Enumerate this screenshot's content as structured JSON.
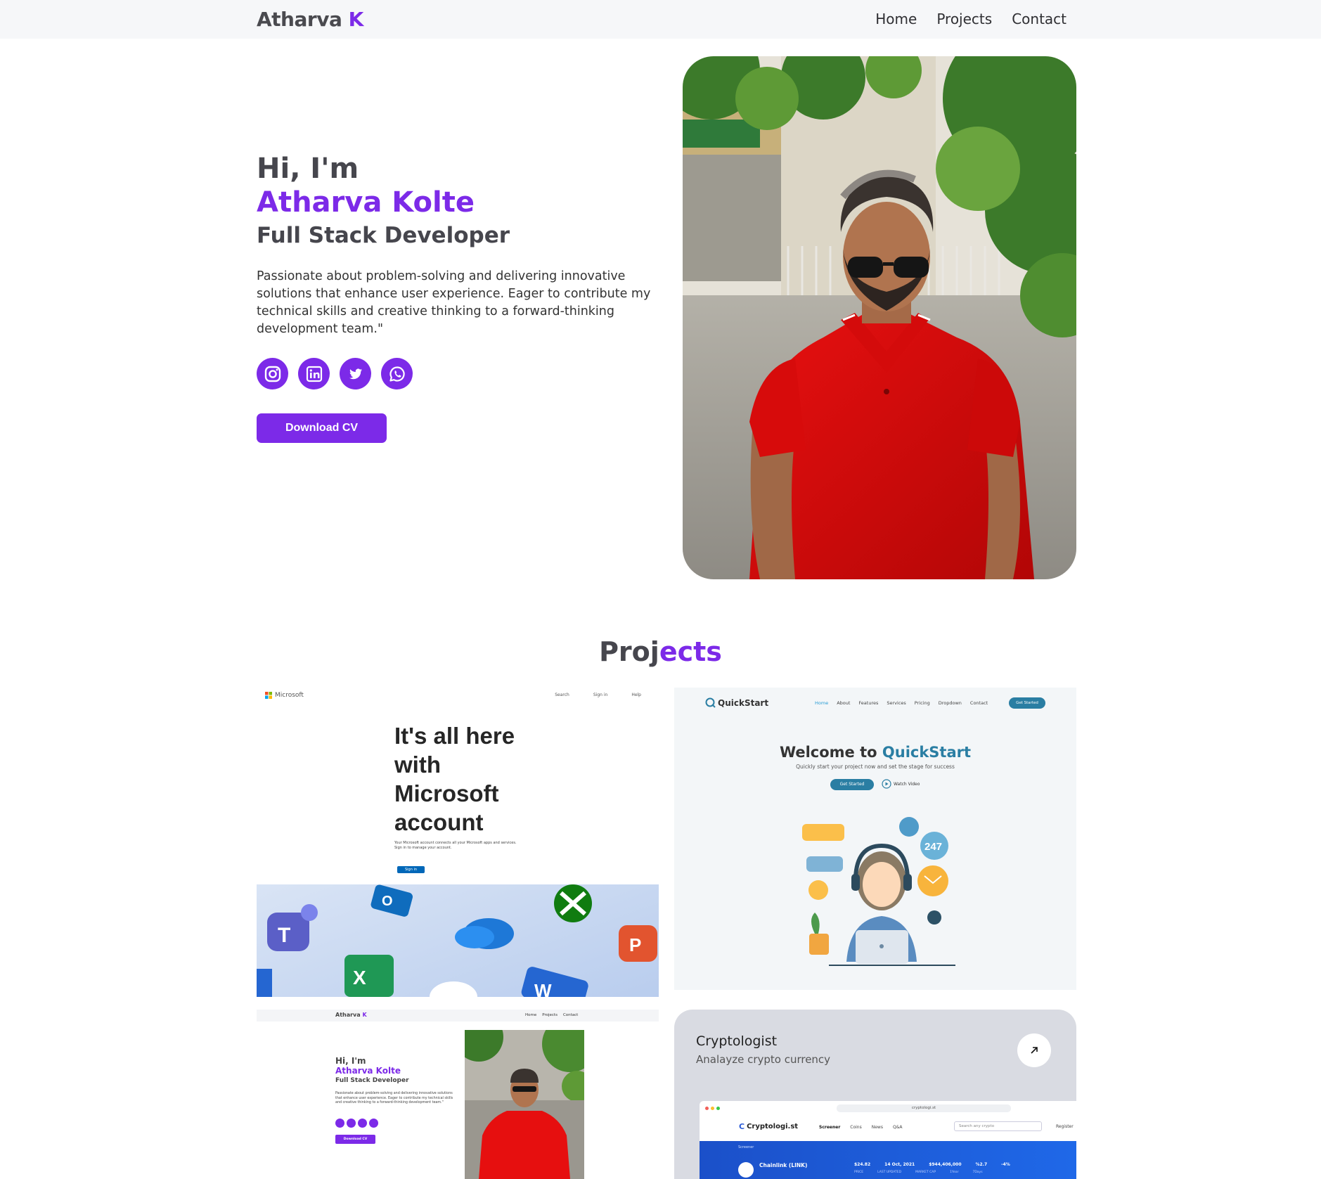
{
  "header": {
    "brand_first": "Atharva",
    "brand_last": "K",
    "nav": [
      "Home",
      "Projects",
      "Contact"
    ]
  },
  "hero": {
    "greeting": "Hi, I'm",
    "name": "Atharva Kolte",
    "role": "Full Stack Developer",
    "bio": "Passionate about problem-solving and delivering innovative solutions that enhance user experience. Eager to contribute my technical skills and creative thinking to a forward-thinking development team.\"",
    "socials": [
      "instagram-icon",
      "linkedin-icon",
      "twitter-icon",
      "whatsapp-icon"
    ],
    "cv_label": "Download CV"
  },
  "projects": {
    "title_a": "Proj",
    "title_b": "ects",
    "ms": {
      "logo": "Microsoft",
      "nav": [
        "Search",
        "Sign in",
        "Help"
      ],
      "headline": "It's all here with Microsoft account",
      "sub": "Your Microsoft account connects all your Microsoft apps and services. Sign in to manage your account.",
      "btn": "Sign in"
    },
    "qs": {
      "logo": "QuickStart",
      "nav": [
        "Home",
        "About",
        "Features",
        "Services",
        "Pricing",
        "Dropdown",
        "Contact"
      ],
      "cta": "Get Started",
      "headline_a": "Welcome to",
      "headline_b": "QuickStart",
      "sub": "Quickly start your project now and set the stage for success",
      "btn1": "Get Started",
      "btn2": "Watch Video",
      "badge": "247"
    },
    "portfolio": {
      "brand_first": "Atharva",
      "brand_last": "K",
      "nav": [
        "Home",
        "Projects",
        "Contact"
      ],
      "greeting": "Hi, I'm",
      "name": "Atharva Kolte",
      "role": "Full Stack Developer",
      "bio": "Passionate about problem-solving and delivering innovative solutions that enhance user experience. Eager to contribute my technical skills and creative thinking to a forward-thinking development team.\"",
      "btn": "Download CV"
    },
    "crypto": {
      "title": "Cryptologist",
      "sub": "Analayze crypto currency",
      "url": "cryptologi.st",
      "logo": "Cryptologi.st",
      "nav": [
        "Screener",
        "Coins",
        "News",
        "Q&A"
      ],
      "search": "Search any crypto",
      "register": "Register",
      "crumb": "Screener",
      "coin": "Chainlink (LINK)",
      "stats": [
        "$24.82",
        "14 Oct, 2021",
        "$944,406,000",
        "%2.7",
        "-4%"
      ],
      "stat_labels": [
        "PRICE",
        "LAST UPDATED",
        "MARKET CAP",
        "1Year",
        "7Days"
      ]
    }
  },
  "colors": {
    "accent": "#7c2ae8",
    "topbar": "#f6f7f9"
  }
}
